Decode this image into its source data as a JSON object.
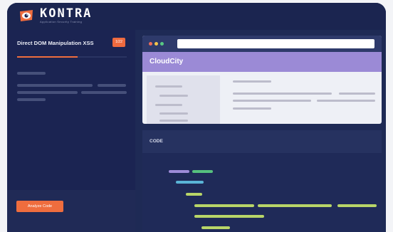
{
  "brand": {
    "name": "KONTRA",
    "tagline": "Application Security Training",
    "icon": "eye-logo-icon",
    "colors": {
      "accent": "#ef6d3e",
      "panel": "#1b2452",
      "browser_bar": "#9b8ad6"
    }
  },
  "lesson": {
    "title": "Direct DOM Manipulation XSS",
    "badge": "1/22",
    "progress_fraction": 0.55,
    "analyze_button": "Analyze Code"
  },
  "browser": {
    "window_dots": [
      "#ef6d5a",
      "#f4c64b",
      "#58c983"
    ],
    "app_title": "CloudCity"
  },
  "code_panel": {
    "label": "CODE",
    "line_colors": {
      "purple": "#9d8bd8",
      "green": "#56c07e",
      "blue": "#5ab4d6",
      "lime": "#b8d568"
    }
  }
}
